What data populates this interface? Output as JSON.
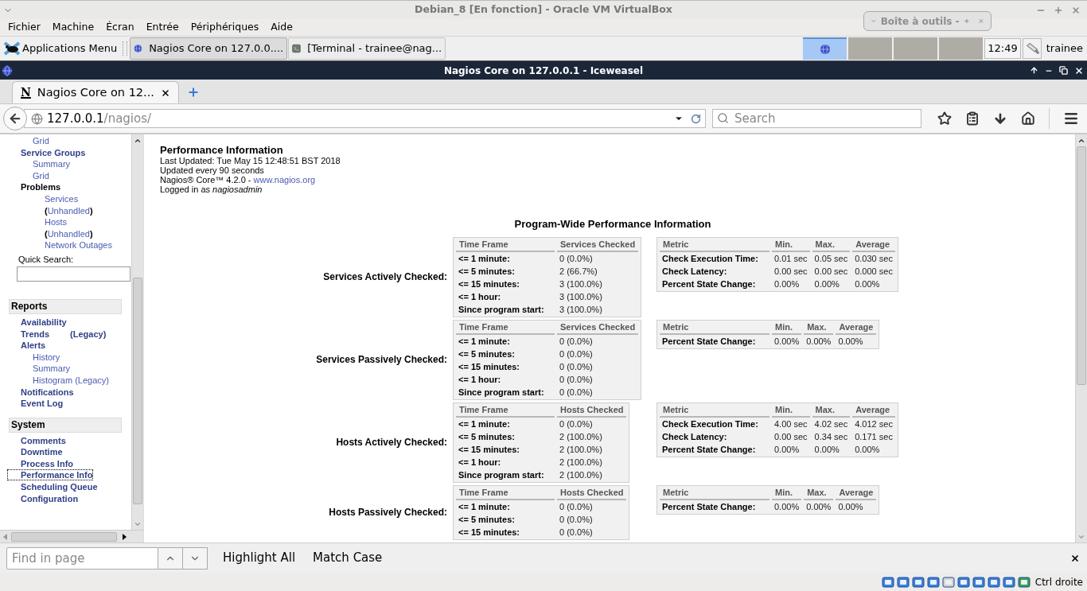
{
  "vm_window": {
    "title": "Debian_8 [En fonction] - Oracle VM VirtualBox",
    "menu": [
      "Fichier",
      "Machine",
      "Écran",
      "Entrée",
      "Périphériques",
      "Aide"
    ],
    "status_text": "Ctrl droite"
  },
  "toolbox": {
    "title": "Boîte à outils -"
  },
  "panel": {
    "app_menu": "Applications Menu",
    "tasks": [
      {
        "label": "Nagios Core on 127.0.0....",
        "kind": "browser",
        "selected": true
      },
      {
        "label": "[Terminal - trainee@nag...",
        "kind": "terminal",
        "selected": false
      }
    ],
    "workspaces": [
      {
        "selected": true
      },
      {
        "selected": false
      },
      {
        "selected": false
      },
      {
        "selected": false
      }
    ],
    "clock": "12:49",
    "user": "trainee"
  },
  "browser": {
    "title": "Nagios Core on 127.0.0.1 - Iceweasel",
    "tab": {
      "icon_text": "N",
      "label": "Nagios Core on 12...",
      "selected": true
    },
    "url": {
      "host": "127.0.0.1",
      "path": "/nagios/"
    },
    "search": {
      "placeholder": "Search"
    },
    "find_bar": {
      "placeholder": "Find in page",
      "options": [
        "Highlight All",
        "Match Case"
      ]
    }
  },
  "sidebar": {
    "groups": [
      {
        "items": [
          {
            "kind": "continued",
            "children": [
              {
                "label": "Grid",
                "kind": "link"
              }
            ]
          },
          {
            "label": "Service Groups",
            "kind": "link",
            "children": [
              {
                "label": "Summary",
                "kind": "link"
              },
              {
                "label": "Grid",
                "kind": "link"
              }
            ]
          },
          {
            "label": "Problems",
            "kind": "category",
            "children": [
              {
                "label": "Services",
                "kind": "link"
              },
              {
                "kind": "paren-link",
                "open": "(",
                "label": "Unhandled",
                "close": ")"
              },
              {
                "label": "Hosts",
                "kind": "link"
              },
              {
                "kind": "paren-link",
                "open": "(",
                "label": "Unhandled",
                "close": ")"
              },
              {
                "label": "Network Outages",
                "kind": "link"
              }
            ]
          }
        ],
        "quick_search": {
          "label": "Quick Search:"
        }
      },
      {
        "heading": "Reports",
        "items": [
          {
            "label": "Availability",
            "kind": "link"
          },
          {
            "label": "Trends",
            "extra": "(Legacy)",
            "kind": "link"
          },
          {
            "label": "Alerts",
            "kind": "link",
            "children": [
              {
                "label": "History",
                "kind": "link"
              },
              {
                "label": "Summary",
                "kind": "link"
              },
              {
                "label": "Histogram (Legacy)",
                "kind": "link"
              }
            ]
          },
          {
            "label": "Notifications",
            "kind": "link"
          },
          {
            "label": "Event Log",
            "kind": "link"
          }
        ]
      },
      {
        "heading": "System",
        "items": [
          {
            "label": "Comments",
            "kind": "link",
            "selected": false
          },
          {
            "label": "Downtime",
            "kind": "link",
            "selected": false
          },
          {
            "label": "Process Info",
            "kind": "link",
            "selected": false
          },
          {
            "label": "Performance Info",
            "kind": "link",
            "selected": true
          },
          {
            "label": "Scheduling Queue",
            "kind": "link",
            "selected": false
          },
          {
            "label": "Configuration",
            "kind": "link",
            "selected": false
          }
        ]
      }
    ]
  },
  "page": {
    "title": "Performance Information",
    "info": [
      "Last Updated: Tue May 15 12:48:51 BST 2018",
      "Updated every 90 seconds"
    ],
    "version": {
      "text": "Nagios® Core™ 4.2.0 - ",
      "link": "www.nagios.org"
    },
    "login": {
      "text": "Logged in as ",
      "user": "nagiosadmin"
    },
    "heading": "Program-Wide Performance Information",
    "sections": [
      {
        "label": "Services Actively Checked:",
        "timeframe": {
          "columns": [
            "Time Frame",
            "Services Checked"
          ],
          "rows": [
            [
              "<= 1 minute:",
              "0 (0.0%)"
            ],
            [
              "<= 5 minutes:",
              "2 (66.7%)"
            ],
            [
              "<= 15 minutes:",
              "3 (100.0%)"
            ],
            [
              "<= 1 hour:",
              "3 (100.0%)"
            ],
            [
              "Since program start:",
              "3 (100.0%)"
            ]
          ]
        },
        "metrics": {
          "columns": [
            "Metric",
            "Min.",
            "Max.",
            "Average"
          ],
          "rows": [
            [
              "Check Execution Time:",
              "0.01 sec",
              "0.05 sec",
              "0.030 sec"
            ],
            [
              "Check Latency:",
              "0.00 sec",
              "0.00 sec",
              "0.000 sec"
            ],
            [
              "Percent State Change:",
              "0.00%",
              "0.00%",
              "0.00%"
            ]
          ]
        }
      },
      {
        "label": "Services Passively Checked:",
        "timeframe": {
          "columns": [
            "Time Frame",
            "Services Checked"
          ],
          "rows": [
            [
              "<= 1 minute:",
              "0 (0.0%)"
            ],
            [
              "<= 5 minutes:",
              "0 (0.0%)"
            ],
            [
              "<= 15 minutes:",
              "0 (0.0%)"
            ],
            [
              "<= 1 hour:",
              "0 (0.0%)"
            ],
            [
              "Since program start:",
              "0 (0.0%)"
            ]
          ]
        },
        "metrics": {
          "columns": [
            "Metric",
            "Min.",
            "Max.",
            "Average"
          ],
          "rows": [
            [
              "Percent State Change:",
              "0.00%",
              "0.00%",
              "0.00%"
            ]
          ]
        }
      },
      {
        "label": "Hosts Actively Checked:",
        "timeframe": {
          "columns": [
            "Time Frame",
            "Hosts Checked"
          ],
          "rows": [
            [
              "<= 1 minute:",
              "0 (0.0%)"
            ],
            [
              "<= 5 minutes:",
              "2 (100.0%)"
            ],
            [
              "<= 15 minutes:",
              "2 (100.0%)"
            ],
            [
              "<= 1 hour:",
              "2 (100.0%)"
            ],
            [
              "Since program start:",
              "2 (100.0%)"
            ]
          ]
        },
        "metrics": {
          "columns": [
            "Metric",
            "Min.",
            "Max.",
            "Average"
          ],
          "rows": [
            [
              "Check Execution Time:",
              "4.00 sec",
              "4.02 sec",
              "4.012 sec"
            ],
            [
              "Check Latency:",
              "0.00 sec",
              "0.34 sec",
              "0.171 sec"
            ],
            [
              "Percent State Change:",
              "0.00%",
              "0.00%",
              "0.00%"
            ]
          ]
        }
      },
      {
        "label": "Hosts Passively Checked:",
        "timeframe": {
          "columns": [
            "Time Frame",
            "Hosts Checked"
          ],
          "rows": [
            [
              "<= 1 minute:",
              "0 (0.0%)"
            ],
            [
              "<= 5 minutes:",
              "0 (0.0%)"
            ],
            [
              "<= 15 minutes:",
              "0 (0.0%)"
            ]
          ]
        },
        "metrics": {
          "columns": [
            "Metric",
            "Min.",
            "Max.",
            "Average"
          ],
          "rows": [
            [
              "Percent State Change:",
              "0.00%",
              "0.00%",
              "0.00%"
            ]
          ]
        }
      }
    ]
  }
}
